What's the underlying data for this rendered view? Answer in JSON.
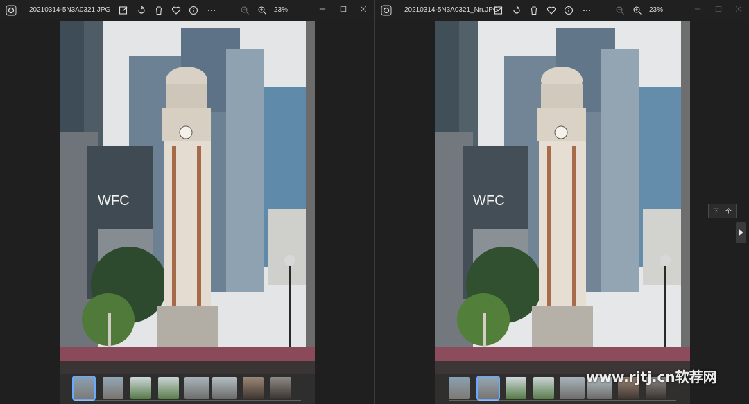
{
  "left": {
    "title": "20210314-5N3A0321.JPG",
    "zoom": "23%"
  },
  "right": {
    "title": "20210314-5N3A0321_Nn.JPG",
    "zoom": "23%",
    "next_tooltip": "下一个"
  },
  "photo": {
    "sign_text": "WFC"
  },
  "watermark": "www.rjtj.cn软荐网",
  "colors": {
    "titlebar": "#202020",
    "background": "#1f1f1f",
    "selected_thumb": "#6aa9ff"
  },
  "icons": [
    "app-icon",
    "edit-icon",
    "rotate-icon",
    "delete-icon",
    "favorite-icon",
    "info-icon",
    "more-icon",
    "zoom-out-icon",
    "zoom-in-icon",
    "minimize-icon",
    "maximize-icon",
    "close-icon",
    "chevron-right-icon"
  ]
}
